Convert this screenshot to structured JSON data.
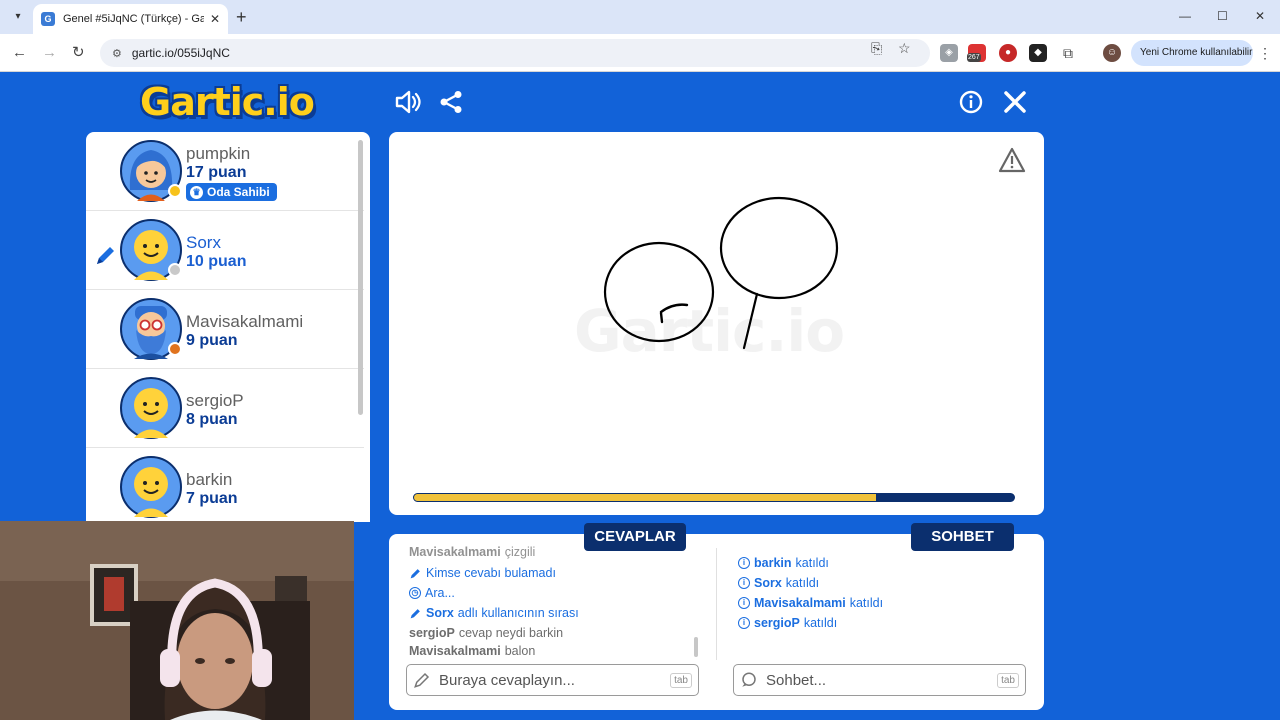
{
  "browser": {
    "tab_title": "Genel #5iJqNC (Türkçe) - Gartic.io",
    "url": "gartic.io/055iJqNC",
    "extension_badge": "267",
    "profile_label": "Yeni Chrome kullanılabilir"
  },
  "game": {
    "logo": "Gartic.io",
    "watermark": "Gartic.io",
    "round_progress": 0.77
  },
  "players": [
    {
      "name": "pumpkin",
      "score": "17 puan",
      "badge": "Oda Sahibi",
      "status_color": "#f7c21b",
      "avatar": "girl-avatar-icon"
    },
    {
      "name": "Sorx",
      "score": "10 puan",
      "drawing": true,
      "status_color": "#c9c9c9",
      "avatar": "smiley-avatar-icon"
    },
    {
      "name": "Mavisakalmami",
      "score": "9 puan",
      "status_color": "#e0731e",
      "avatar": "bearded-avatar-icon"
    },
    {
      "name": "sergioP",
      "score": "8 puan",
      "avatar": "smiley-avatar-icon"
    },
    {
      "name": "barkin",
      "score": "7 puan",
      "avatar": "smiley-avatar-icon"
    }
  ],
  "answers": {
    "title": "CEVAPLAR",
    "lines": [
      {
        "user": "Mavisakalmami",
        "text": "çizgili"
      },
      {
        "text": "Kimse cevabı bulamadı"
      },
      {
        "text": "Ara..."
      },
      {
        "user": "Sorx",
        "text": "adlı kullanıcının sırası"
      },
      {
        "user": "sergioP",
        "text": "cevap neydi barkin"
      },
      {
        "user": "Mavisakalmami",
        "text": "balon"
      }
    ],
    "placeholder": "Buraya cevaplayın...",
    "shortcut": "tab"
  },
  "chat": {
    "title": "SOHBET",
    "lines": [
      {
        "user": "barkin",
        "text": "katıldı"
      },
      {
        "user": "Sorx",
        "text": "katıldı"
      },
      {
        "user": "Mavisakalmami",
        "text": "katıldı"
      },
      {
        "user": "sergioP",
        "text": "katıldı"
      }
    ],
    "placeholder": "Sohbet...",
    "shortcut": "tab"
  },
  "colors": {
    "background": "#1262d8",
    "navy": "#0b2f6e",
    "accent_blue": "#1b6ee0",
    "logo_yellow": "#ffcf1b",
    "progress_yellow": "#f0c23b"
  }
}
